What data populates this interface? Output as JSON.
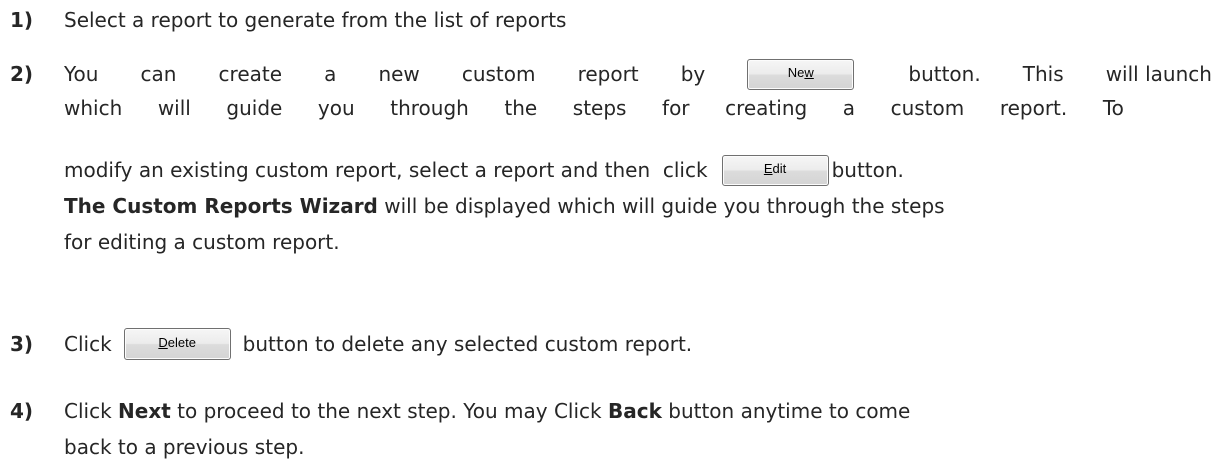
{
  "steps": [
    {
      "num": "1)",
      "text": "Select a report to generate from the list of reports"
    },
    {
      "num": "2)",
      "l1_w": [
        "You",
        "can",
        "create",
        "a",
        "new",
        "custom",
        "report",
        "by"
      ],
      "new_button": {
        "pre": "Ne",
        "underlined": "w",
        "post": ""
      },
      "l1_after_w": [
        "button.",
        "This",
        "will launch"
      ],
      "l2_w": [
        "which",
        "will",
        "guide",
        "you",
        "through",
        "the",
        "steps",
        "for",
        "creating",
        "a",
        "custom",
        "report.",
        "To"
      ],
      "l3_pre": "modify an existing custom report, select a report and then  click",
      "edit_button": {
        "pre": "",
        "underlined": "E",
        "post": "dit"
      },
      "l3_post": "button.",
      "l4_bold": "The Custom Reports Wizard",
      "l4_rest": "will be displayed which will guide you through the steps",
      "l5": "for editing a custom report."
    },
    {
      "num": "3)",
      "pre": "Click",
      "delete_button": {
        "pre": "",
        "underlined": "D",
        "post": "elete"
      },
      "post": "button to delete any selected custom report."
    },
    {
      "num": "4)",
      "l1_a": "Click",
      "l1_next": "Next",
      "l1_b": "to proceed to the next step. You may Click",
      "l1_back": "Back",
      "l1_c": "button anytime to come",
      "l2": "back to a previous step."
    }
  ]
}
